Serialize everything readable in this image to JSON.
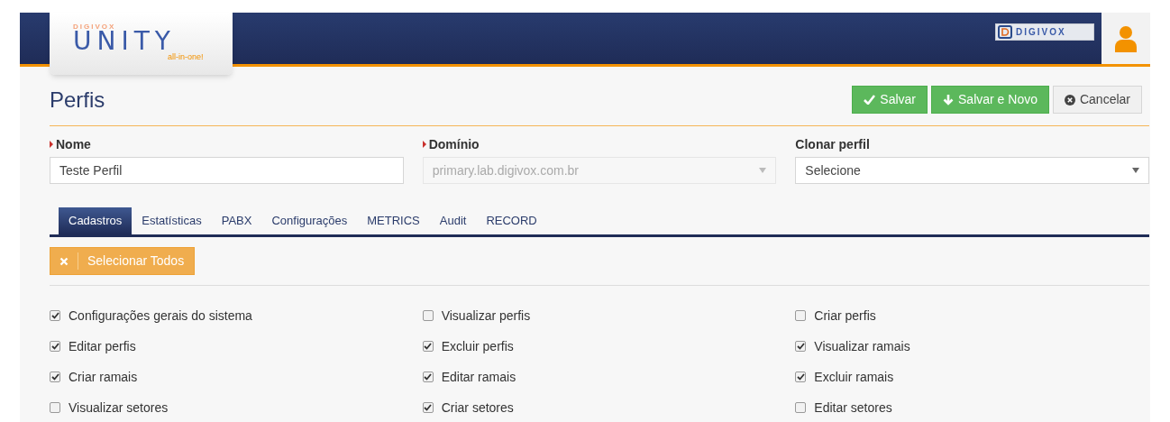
{
  "header": {
    "logo": {
      "brand": "DIGIVOX",
      "product": "UNITY",
      "tagline": "all-in-one!"
    },
    "partner_logo": "DIGIVOX"
  },
  "page": {
    "title": "Perfis"
  },
  "actions": [
    {
      "label": "Salvar",
      "kind": "save"
    },
    {
      "label": "Salvar e Novo",
      "kind": "save-new"
    },
    {
      "label": "Cancelar",
      "kind": "cancel"
    }
  ],
  "fields": [
    {
      "label": "Nome",
      "required": true,
      "kind": "text",
      "value": "Teste Perfil",
      "disabled": false
    },
    {
      "label": "Domínio",
      "required": true,
      "kind": "select",
      "value": "primary.lab.digivox.com.br",
      "disabled": true
    },
    {
      "label": "Clonar perfil",
      "required": false,
      "kind": "select",
      "value": "Selecione",
      "disabled": false
    }
  ],
  "tabs": [
    {
      "label": "Cadastros",
      "selected": true
    },
    {
      "label": "Estatísticas",
      "selected": false
    },
    {
      "label": "PABX",
      "selected": false
    },
    {
      "label": "Configurações",
      "selected": false
    },
    {
      "label": "METRICS",
      "selected": false
    },
    {
      "label": "Audit",
      "selected": false
    },
    {
      "label": "RECORD",
      "selected": false
    }
  ],
  "select_all_button": "Selecionar Todos",
  "permissions": [
    {
      "label": "Configurações gerais do sistema",
      "checked": true
    },
    {
      "label": "Visualizar perfis",
      "checked": false
    },
    {
      "label": "Criar perfis",
      "checked": false
    },
    {
      "label": "Editar perfis",
      "checked": true
    },
    {
      "label": "Excluir perfis",
      "checked": true
    },
    {
      "label": "Visualizar ramais",
      "checked": true
    },
    {
      "label": "Criar ramais",
      "checked": true
    },
    {
      "label": "Editar ramais",
      "checked": true
    },
    {
      "label": "Excluir ramais",
      "checked": true
    },
    {
      "label": "Visualizar setores",
      "checked": false
    },
    {
      "label": "Criar setores",
      "checked": true
    },
    {
      "label": "Editar setores",
      "checked": false
    }
  ]
}
